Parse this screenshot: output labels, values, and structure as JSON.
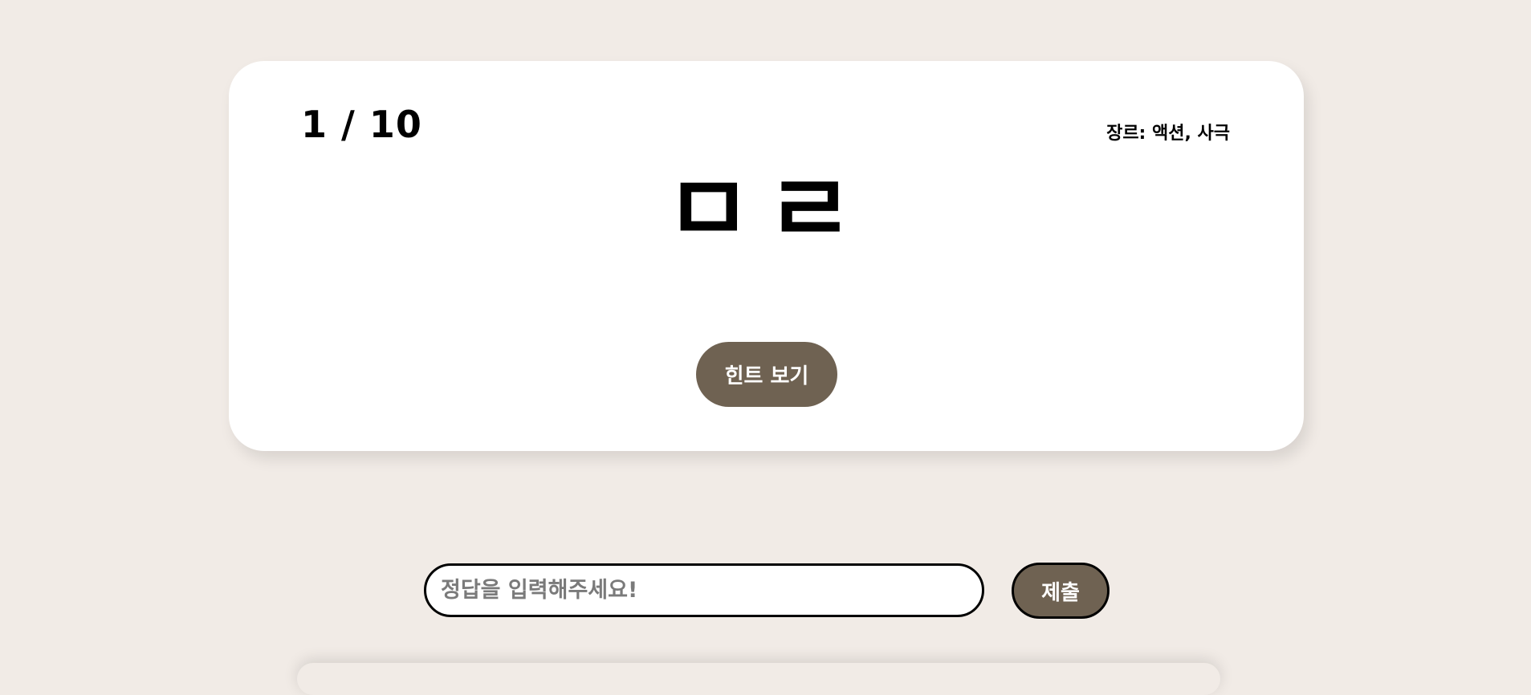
{
  "quiz": {
    "progress": "1 / 10",
    "genre": "장르: 액션, 사극",
    "chosung": "ㅁㄹ",
    "hint_button": "힌트 보기"
  },
  "answer": {
    "placeholder": "정답을 입력해주세요!",
    "value": "",
    "submit_button": "제출"
  },
  "colors": {
    "background": "#f1ebe6",
    "card": "#ffffff",
    "accent": "#6f6252"
  }
}
